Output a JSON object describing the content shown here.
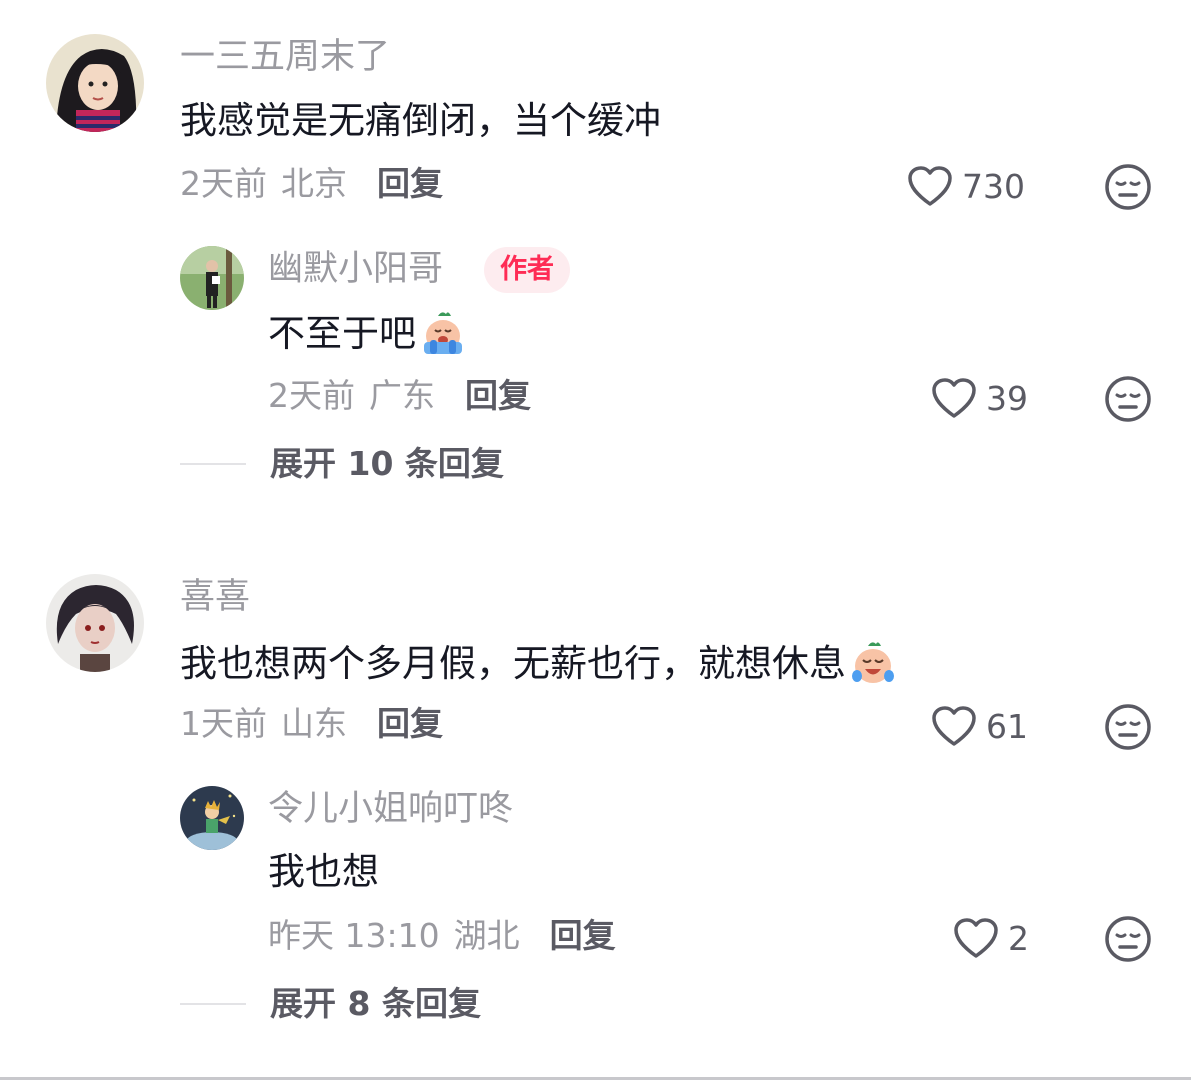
{
  "comments": [
    {
      "username": "一三五周末了",
      "content": "我感觉是无痛倒闭，当个缓冲",
      "time": "2天前",
      "location": "北京",
      "reply_label": "回复",
      "likes": "730",
      "reply": {
        "username": "幽默小阳哥",
        "badge": "作者",
        "content": "不至于吧",
        "emoji": "crying-emoji",
        "time": "2天前",
        "location": "广东",
        "reply_label": "回复",
        "likes": "39"
      },
      "expand_label": "展开 10 条回复"
    },
    {
      "username": "喜喜",
      "content": "我也想两个多月假，无薪也行，就想休息",
      "emoji": "crying-emoji",
      "time": "1天前",
      "location": "山东",
      "reply_label": "回复",
      "likes": "61",
      "reply": {
        "username": "令儿小姐响叮咚",
        "content": "我也想",
        "time": "昨天 13:10",
        "location": "湖北",
        "reply_label": "回复",
        "likes": "2"
      },
      "expand_label": "展开 8 条回复"
    }
  ],
  "colors": {
    "accent": "#fe2c55",
    "badge_bg": "#fdecef",
    "secondary_text": "#9a9aa0",
    "primary_text": "#161823"
  }
}
